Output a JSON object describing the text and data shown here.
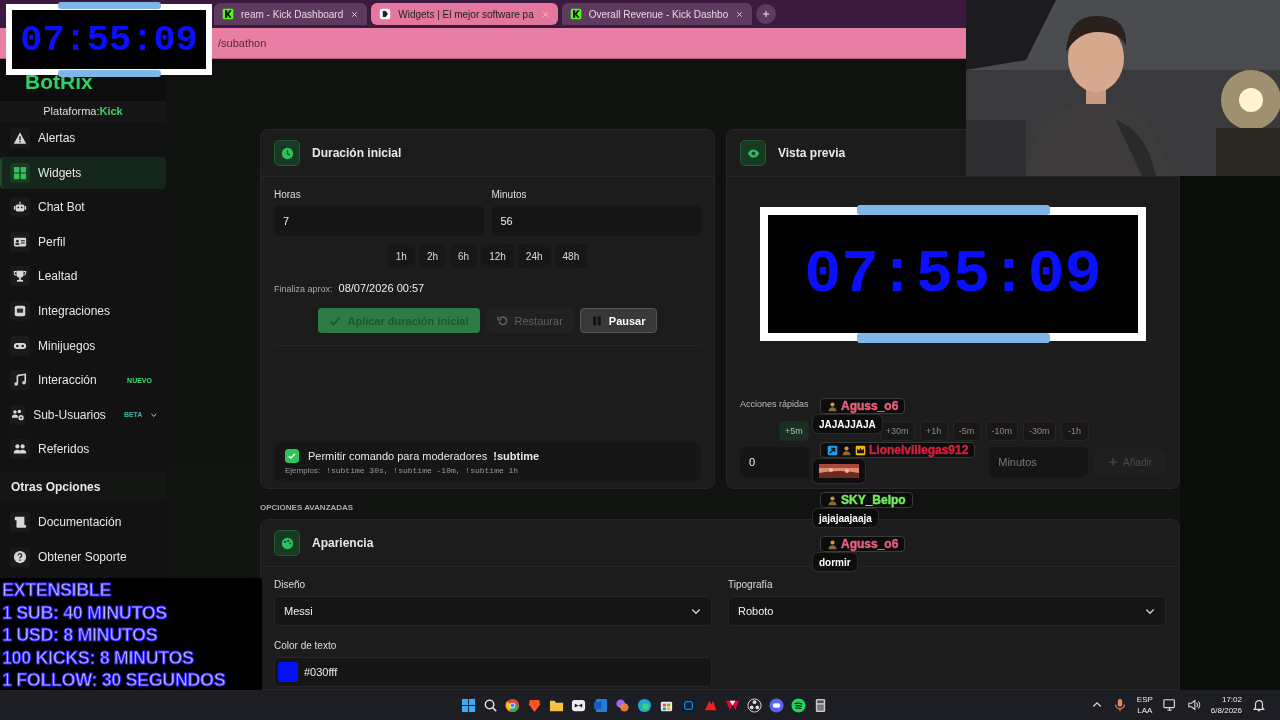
{
  "browser": {
    "tabs": [
      {
        "label": "ream - Kick Dashboard",
        "selected": false
      },
      {
        "label": "Widgets | El mejor software pa",
        "selected": true
      },
      {
        "label": "Overall Revenue - Kick Dashbo",
        "selected": false
      }
    ],
    "address": "/subathon"
  },
  "app": {
    "logo": "BotRix",
    "platform_label": "Plataforma:",
    "platform": "Kick"
  },
  "sidebar": {
    "items": [
      {
        "label": "Alertas",
        "selected": false
      },
      {
        "label": "Widgets",
        "selected": true
      },
      {
        "label": "Chat Bot",
        "selected": false
      },
      {
        "label": "Perfil",
        "selected": false
      },
      {
        "label": "Lealtad",
        "selected": false
      },
      {
        "label": "Integraciones",
        "selected": false
      },
      {
        "label": "Minijuegos",
        "selected": false
      },
      {
        "label": "Interacción",
        "selected": false,
        "badge": "NUEVO"
      },
      {
        "label": "Sub-Usuarios",
        "selected": false,
        "badge": "BETA",
        "expandable": true
      },
      {
        "label": "Referidos",
        "selected": false
      }
    ],
    "section_title": "Otras Opciones",
    "extra_items": [
      {
        "label": "Documentación",
        "selected": false
      },
      {
        "label": "Obtener Soporte",
        "selected": false
      }
    ]
  },
  "duration_card": {
    "title": "Duración inicial",
    "hours_label": "Horas",
    "hours": "7",
    "minutes_label": "Minutos",
    "minutes": "56",
    "presets": [
      "1h",
      "2h",
      "6h",
      "12h",
      "24h",
      "48h"
    ],
    "end_label": "Finaliza aprox:",
    "end_value": "08/07/2026 00:57",
    "buttons": [
      {
        "label": "Aplicar duración inicial",
        "kind": "primary",
        "disabled": false
      },
      {
        "label": "Restaurar",
        "kind": "reset",
        "disabled": true
      },
      {
        "label": "Pausar",
        "kind": "pause",
        "disabled": false
      }
    ],
    "moderator_command": {
      "label": "Permitir comando para moderadores  **!subtime**",
      "checked": true,
      "examples_label": "Ejemplos:",
      "examples": "!subtime 30s, !subtime -10m, !subtime 1h"
    }
  },
  "preview_card": {
    "title": "Vista previa",
    "timer": "07:55:09",
    "quick_actions_label": "Acciones rápidas",
    "quick_actions": [
      {
        "label": "+5m",
        "kind": "add"
      },
      {
        "label": "+30m",
        "kind": "add"
      },
      {
        "label": "+1h",
        "kind": "add"
      },
      {
        "label": "-5m",
        "kind": "subtract"
      },
      {
        "label": "-10m",
        "kind": "subtract"
      },
      {
        "label": "-30m",
        "kind": "subtract"
      },
      {
        "label": "-1h",
        "kind": "subtract"
      }
    ],
    "amount": "0",
    "unit": "Minutos",
    "add_button": {
      "label": "Añadir",
      "disabled": true
    }
  },
  "advanced_label": "OPCIONES AVANZADAS",
  "appearance_card": {
    "title": "Apariencia",
    "design_label": "Diseño",
    "design": "Messi",
    "font_label": "Tipografía",
    "font": "Roboto",
    "text_color_label": "Color de texto",
    "text_color": "#030fff"
  },
  "chat_overlay": [
    {
      "user": "Aguss_o6",
      "color": "#e8607c",
      "verified": false,
      "founder": false,
      "kind": "text",
      "message": "JAJAJJAJA"
    },
    {
      "user": "Lionelvillegas912",
      "color": "#d8203c",
      "verified": true,
      "founder": true,
      "kind": "emote"
    },
    {
      "user": "SKY_Belpo",
      "color": "#72f05c",
      "verified": false,
      "founder": false,
      "kind": "text",
      "message": "jajajaajaaja"
    },
    {
      "user": "Aguss_o6",
      "color": "#e8607c",
      "verified": false,
      "founder": false,
      "kind": "text",
      "message": "dormir"
    }
  ],
  "stream_overlay": {
    "timer": "07:55:09",
    "lines": [
      "EXTENSIBLE",
      "1 SUB: 40 MINUTOS",
      "1 USD: 8 MINUTOS",
      "100 KICKS: 8 MINUTOS",
      "1 FOLLOW: 30 SEGUNDOS"
    ]
  },
  "taskbar": {
    "language": "ESP",
    "layout": "LAA",
    "time": "17:02",
    "date": "6/8/2026"
  }
}
